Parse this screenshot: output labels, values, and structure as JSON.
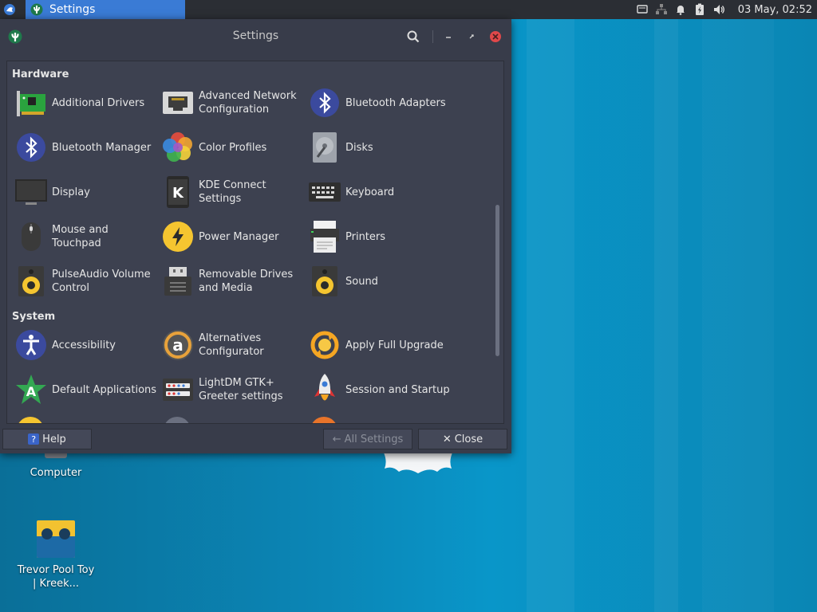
{
  "panel": {
    "taskbar_title": "Settings",
    "clock": "03 May, 02:52",
    "icons": [
      "xfce-logo-icon",
      "app-menu-icon",
      "window-icon",
      "chat-icon",
      "network-icon",
      "bell-icon",
      "battery-icon",
      "volume-icon"
    ]
  },
  "window": {
    "title": "Settings",
    "sections": [
      {
        "title": "Hardware",
        "items": [
          {
            "label": "Additional Drivers",
            "icon": "pcb-card-icon"
          },
          {
            "label": "Advanced Network Configuration",
            "icon": "ethernet-port-icon"
          },
          {
            "label": "Bluetooth Adapters",
            "icon": "bluetooth-icon"
          },
          {
            "label": "Bluetooth Manager",
            "icon": "bluetooth-icon"
          },
          {
            "label": "Color Profiles",
            "icon": "color-flower-icon"
          },
          {
            "label": "Disks",
            "icon": "disk-icon"
          },
          {
            "label": "Display",
            "icon": "monitor-icon"
          },
          {
            "label": "KDE Connect Settings",
            "icon": "kde-connect-icon"
          },
          {
            "label": "Keyboard",
            "icon": "keyboard-icon"
          },
          {
            "label": "Mouse and Touchpad",
            "icon": "mouse-icon"
          },
          {
            "label": "Power Manager",
            "icon": "lightning-icon"
          },
          {
            "label": "Printers",
            "icon": "printer-icon"
          },
          {
            "label": "PulseAudio Volume Control",
            "icon": "speaker-icon"
          },
          {
            "label": "Removable Drives and Media",
            "icon": "usb-drive-icon"
          },
          {
            "label": "Sound",
            "icon": "speaker-icon"
          }
        ]
      },
      {
        "title": "System",
        "items": [
          {
            "label": "Accessibility",
            "icon": "accessibility-icon"
          },
          {
            "label": "Alternatives Configurator",
            "icon": "alternatives-icon"
          },
          {
            "label": "Apply Full Upgrade",
            "icon": "upgrade-icon"
          },
          {
            "label": "Default Applications",
            "icon": "default-apps-star-icon"
          },
          {
            "label": "LightDM GTK+ Greeter settings",
            "icon": "lightdm-icon"
          },
          {
            "label": "Session and Startup",
            "icon": "rocket-icon"
          }
        ]
      }
    ],
    "buttons": {
      "help": "Help",
      "all_settings": "All Settings",
      "close": "Close"
    }
  },
  "desktop": {
    "icons": [
      {
        "label": "Computer"
      },
      {
        "label": "Trevor Pool Toy | Kreek..."
      }
    ]
  },
  "colors": {
    "panel_bg": "#2b2e34",
    "taskbar_active": "#3a7bd5",
    "window_bg": "#383c4a",
    "content_bg": "#3d4150",
    "close_red": "#e0484a",
    "desktop_blue": "#0b86b6"
  }
}
